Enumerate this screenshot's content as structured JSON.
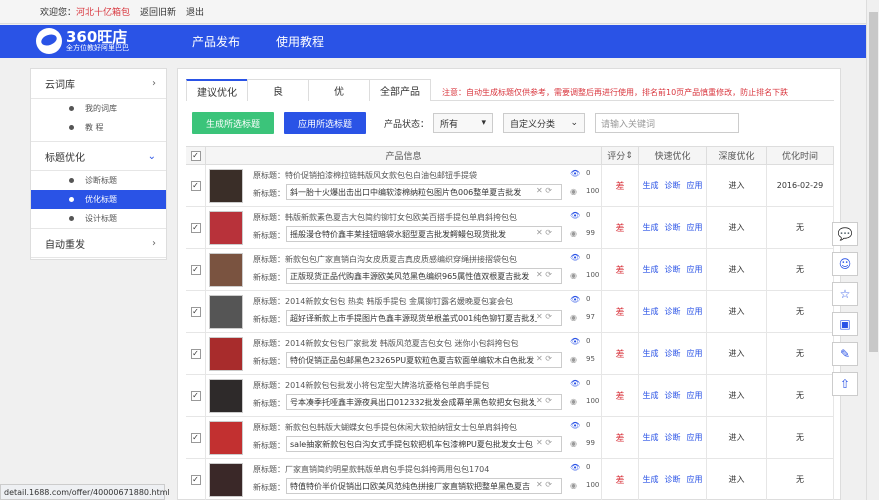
{
  "topbar": {
    "welcome": "欢迎您：",
    "shop": "河北十亿箱包",
    "back": "返回旧新",
    "logout": "退出"
  },
  "logo": {
    "main": "360旺店",
    "sub": "全方位教好阿里巴巴"
  },
  "nav": [
    "产品发布",
    "使用教程"
  ],
  "sidebar": {
    "sections": [
      {
        "label": "云词库",
        "items": [
          "我的词库",
          "教 程"
        ]
      },
      {
        "label": "标题优化",
        "items": [
          "诊断标题",
          "优化标题",
          "设计标题"
        ]
      },
      {
        "label": "自动重发",
        "items": []
      }
    ],
    "active": "优化标题"
  },
  "tabs": [
    "建议优化",
    "良",
    "优",
    "全部产品"
  ],
  "notice": "注意：自动生成标题仅供参考，需要调整后再进行使用，排名前10页产品慎重修改，防止排名下跌",
  "toolbar": {
    "generate": "生成所选标题",
    "apply": "应用所选标题",
    "status_label": "产品状态：",
    "status_value": "所有",
    "category": "自定义分类",
    "search_placeholder": "请输入关键词"
  },
  "table": {
    "headers": [
      "产品信息",
      "评分",
      "快速优化",
      "深度优化",
      "优化时间"
    ],
    "orig_prefix": "原标题：",
    "new_prefix": "新标题：",
    "fast_actions": [
      "生成",
      "诊断",
      "应用"
    ],
    "deep_action": "进入",
    "rows": [
      {
        "orig": "特价促销拍漆棉拉链韩版风女款包包白油包邮钮手提袋",
        "new": "斜一胎十火爆出击出口中编软漆棉纳粒包图片色006整单夏吉批发",
        "views": "0",
        "count": "100",
        "score": "差",
        "time": "2016-02-29",
        "color": "#3a2e28"
      },
      {
        "orig": "韩版新款素色夏吉大包简约铆钉女包欧美百搭手提包单肩斜挎包包",
        "new": "摇般漫仓特价鑫丰莱挂钮暗袋水貂型夏吉批发鳄鳗包现货批发",
        "views": "0",
        "count": "99",
        "score": "差",
        "time": "无",
        "color": "#b8323a"
      },
      {
        "orig": "新款包包广家直销白沟女皮质夏吉真皮质感编织穿绳拼接摺袋包包",
        "new": "正版现货正品代购鑫丰源欧美风范黑色编织965属性值双根夏吉批发",
        "views": "0",
        "count": "100",
        "score": "差",
        "time": "无",
        "color": "#7a5340"
      },
      {
        "orig": "2014新款女包包 热卖 韩版手提包 金属铆钉露名媛晚夏包宴会包",
        "new": "超好译新款上市手提图片色鑫丰源现货单根盖式001纯色铆钉夏吉批发",
        "views": "0",
        "count": "97",
        "score": "差",
        "time": "无",
        "color": "#555"
      },
      {
        "orig": "2014新款女包包厂家批发 韩版风范夏吉包女包 迷你小包斜挎包包",
        "new": "特价促销正品包邮黑色23265PU夏软粒色夏吉软面单编软木白色批发",
        "views": "0",
        "count": "95",
        "score": "差",
        "time": "无",
        "color": "#a82c2c"
      },
      {
        "orig": "2014新款包包批发小将包定型大牌洛坑菱格包单肩手提包",
        "new": "号本凑季托哑鑫丰源夜具出口012332批发会成幕单黑色软把女包批发",
        "views": "0",
        "count": "100",
        "score": "差",
        "time": "无",
        "color": "#2e2a2a"
      },
      {
        "orig": "新款包包韩版大蝴蝶女包手提包休闲大软拍纳钮女士包单肩斜挎包",
        "new": "sale抽家新款包包白沟女式手提包软把机车包漆棉PU夏包批发女士包",
        "views": "0",
        "count": "99",
        "score": "差",
        "time": "无",
        "color": "#c23030"
      },
      {
        "orig": "厂家直销简约明星款韩版单肩包手提包斜挎两用包包1704",
        "new": "特值特价半价促销出口欧美风范纯色拼接厂家直销软把整单黑色夏吉",
        "views": "0",
        "count": "100",
        "score": "差",
        "time": "无",
        "color": "#3a2828"
      }
    ]
  },
  "side_tools": [
    "chat-icon",
    "face-icon",
    "star-icon",
    "screen-icon",
    "pen-icon",
    "top-icon"
  ],
  "statusbar": "detail.1688.com/offer/40000671880.html"
}
